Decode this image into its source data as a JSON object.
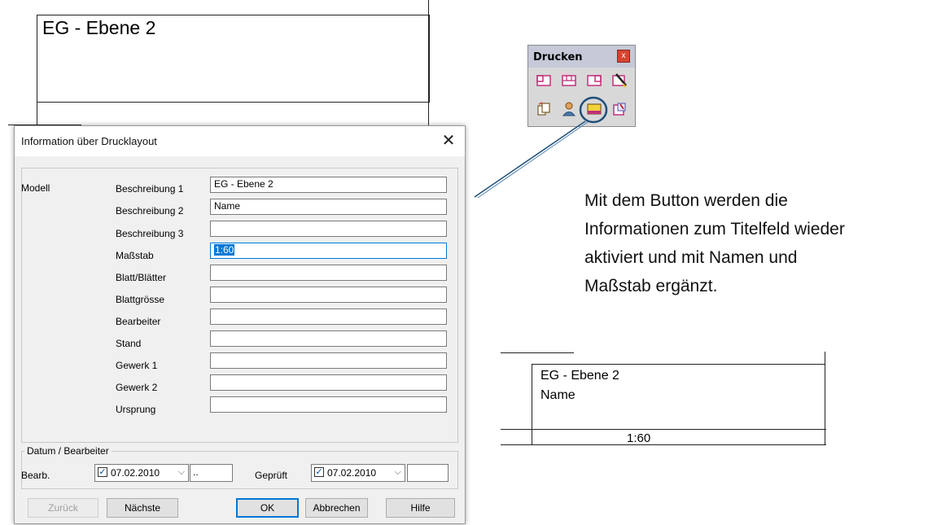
{
  "top_titleblock": {
    "text": "EG - Ebene 2"
  },
  "dialog": {
    "title": "Information über Drucklayout",
    "close_icon": "close-icon",
    "group_label": "Modell",
    "fields": [
      {
        "label": "Beschreibung 1",
        "value": "EG - Ebene 2"
      },
      {
        "label": "Beschreibung 2",
        "value": "Name"
      },
      {
        "label": "Beschreibung 3",
        "value": ""
      },
      {
        "label": "Maßstab",
        "value": "1:60"
      },
      {
        "label": "Blatt/Blätter",
        "value": ""
      },
      {
        "label": "Blattgrösse",
        "value": ""
      },
      {
        "label": "Bearbeiter",
        "value": ""
      },
      {
        "label": "Stand",
        "value": ""
      },
      {
        "label": "Gewerk 1",
        "value": ""
      },
      {
        "label": "Gewerk 2",
        "value": ""
      },
      {
        "label": "Ursprung",
        "value": ""
      }
    ],
    "date_group": {
      "label": "Datum / Bearbeiter",
      "bearb_label": "Bearb.",
      "bearb_date": "07.02.2010",
      "bearb_extra": "..",
      "geprueft_label": "Geprüft",
      "geprueft_date": "07.02.2010",
      "geprueft_extra": ""
    },
    "buttons": {
      "back": "Zurück",
      "next": "Nächste",
      "ok": "OK",
      "cancel": "Abbrechen",
      "help": "Hilfe"
    }
  },
  "toolbar": {
    "title": "Drucken",
    "close": "x",
    "icons": [
      "layout-left-icon",
      "layout-center-icon",
      "layout-right-icon",
      "pen-icon",
      "copy-pages-icon",
      "person-icon",
      "titlefield-info-icon",
      "edit-page-icon"
    ]
  },
  "callout": {
    "lines": [
      "Mit dem Button werden die",
      "Informationen zum Titelfeld wieder",
      "aktiviert und mit Namen und",
      "Maßstab ergänzt."
    ]
  },
  "bottom_titleblock": {
    "line1": "EG - Ebene 2",
    "line2": "Name",
    "scale": "1:60"
  },
  "colors": {
    "accent": "#0078d7",
    "highlight_circle": "#1f4e79",
    "toolbar_head": "#c5c9d8"
  }
}
